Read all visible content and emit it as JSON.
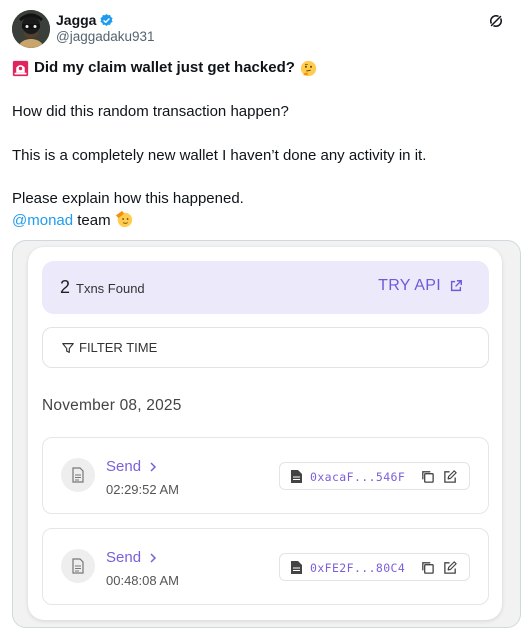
{
  "author": {
    "display_name": "Jagga",
    "handle": "@jaggadaku931",
    "verified": true,
    "avatar_icon": "masked-man-avatar"
  },
  "post": {
    "title": "Did my claim wallet just get hacked?",
    "title_prefix_icon": "siren-emoji",
    "title_suffix_icon": "thinking-face-emoji",
    "line1": "How did this random transaction happen?",
    "line2": "This is a completely new wallet I haven’t done any activity in it.",
    "line3": "Please explain how this happened.",
    "mention": "@monad",
    "mention_suffix": " team",
    "end_icon": "saluting-face-emoji"
  },
  "embed": {
    "txn_count": "2",
    "txn_found_label": "Txns Found",
    "try_api_label": "TRY API",
    "filter_label": "FILTER TIME",
    "date": "November 08, 2025",
    "transactions": [
      {
        "type": "Send",
        "time": "02:29:52 AM",
        "hash": "0xacaF...546F"
      },
      {
        "type": "Send",
        "time": "00:48:08 AM",
        "hash": "0xFE2F...80C4"
      }
    ]
  },
  "colors": {
    "accent_purple": "#7b5fd9",
    "found_bar_bg": "#ece9fb",
    "mention_blue": "#1d9bf0",
    "verified_blue": "#1d9bf0"
  }
}
